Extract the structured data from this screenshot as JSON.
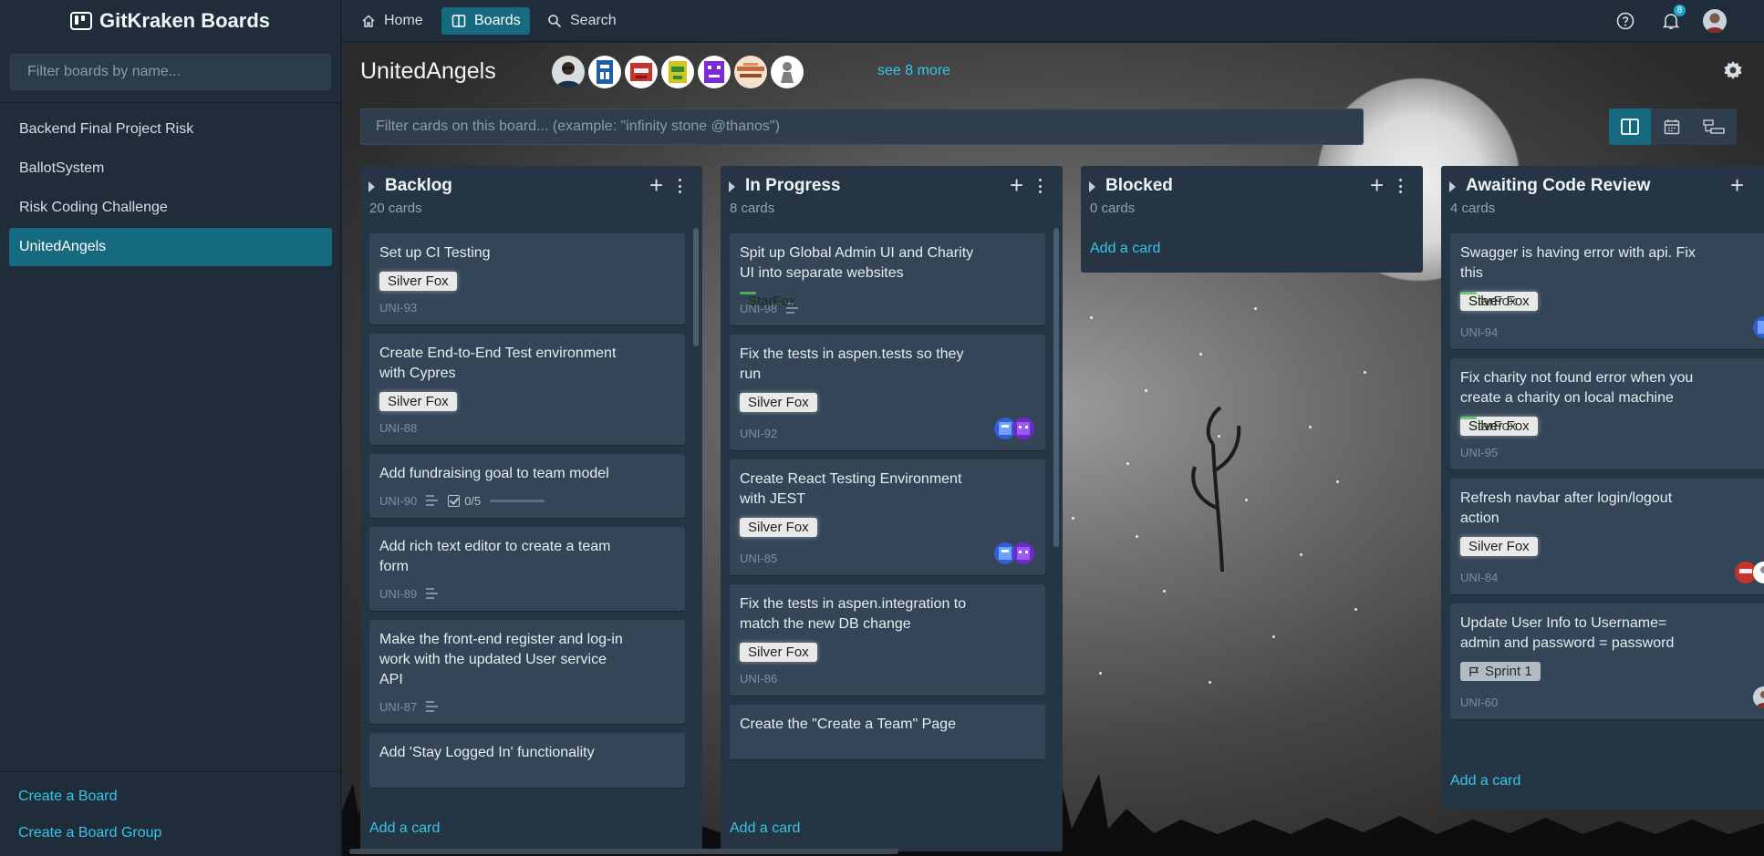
{
  "app": {
    "logo_text": "GitKraken Boards"
  },
  "sidebar": {
    "filter_placeholder": "Filter boards by name...",
    "boards": [
      {
        "label": "Backend Final Project Risk",
        "active": false
      },
      {
        "label": "BallotSystem",
        "active": false
      },
      {
        "label": "Risk Coding Challenge",
        "active": false
      },
      {
        "label": "UnitedAngels",
        "active": true
      }
    ],
    "create_board": "Create a Board",
    "create_board_group": "Create a Board Group"
  },
  "topnav": {
    "home": "Home",
    "boards": "Boards",
    "search": "Search",
    "notification_count": "8",
    "icons": [
      "help-icon",
      "bell-icon",
      "user-avatar"
    ]
  },
  "board": {
    "title": "UnitedAngels",
    "see_more": "see 8 more",
    "filter_placeholder": "Filter cards on this board... (example: \"infinity stone @thanos\")",
    "views": [
      "board-view-icon",
      "calendar-view-icon",
      "timeline-view-icon"
    ],
    "add_card": "Add a card",
    "columns": [
      {
        "title": "Backlog",
        "count": "20 cards",
        "cards": [
          {
            "title": "Set up CI Testing",
            "labels": [
              "Silver Fox"
            ],
            "id": "UNI-93"
          },
          {
            "title": "Create End-to-End Test environment with Cypres",
            "labels": [
              "Silver Fox"
            ],
            "id": "UNI-88"
          },
          {
            "title": "Add fundraising goal to team model",
            "id": "UNI-90",
            "checklist": "0/5"
          },
          {
            "title": "Add rich text editor to create a team form",
            "id": "UNI-89"
          },
          {
            "title": "Make the front-end register and log-in work with the updated User service API",
            "id": "UNI-87"
          },
          {
            "title": "Add 'Stay Logged In' functionality"
          }
        ]
      },
      {
        "title": "In Progress",
        "count": "8 cards",
        "cards": [
          {
            "title": "Spit up Global Admin UI and Charity UI into separate websites",
            "labels": [
              "StarFox"
            ],
            "id": "UNI-98"
          },
          {
            "title": "Fix the tests in aspen.tests so they run",
            "labels": [
              "Silver Fox"
            ],
            "id": "UNI-92"
          },
          {
            "title": "Create React Testing Environment with JEST",
            "labels": [
              "Silver Fox"
            ],
            "id": "UNI-85"
          },
          {
            "title": "Fix the tests in aspen.integration to match the new DB change",
            "labels": [
              "Silver Fox"
            ],
            "id": "UNI-86"
          },
          {
            "title": "Create the \"Create a Team\" Page"
          }
        ]
      },
      {
        "title": "Blocked",
        "count": "0 cards",
        "cards": []
      },
      {
        "title": "Awaiting Code Review",
        "count": "4 cards",
        "cards": [
          {
            "title": "Swagger is having error with api. Fix this",
            "labels": [
              "Silver Fox",
              "StarFox"
            ],
            "id": "UNI-94"
          },
          {
            "title": "Fix charity not found error when you create a charity on local machine",
            "labels": [
              "Silver Fox",
              "StarFox"
            ],
            "id": "UNI-95"
          },
          {
            "title": "Refresh navbar after login/logout action",
            "labels": [
              "Silver Fox"
            ],
            "id": "UNI-84"
          },
          {
            "title": "Update User Info to Username= admin and password = password",
            "labels": [
              "Sprint 1"
            ],
            "id": "UNI-60"
          }
        ]
      }
    ]
  },
  "colors": {
    "accent": "#166a80",
    "link": "#36c5ea",
    "starfox": "#55c35a",
    "silverfox": "#e9e9e9"
  }
}
